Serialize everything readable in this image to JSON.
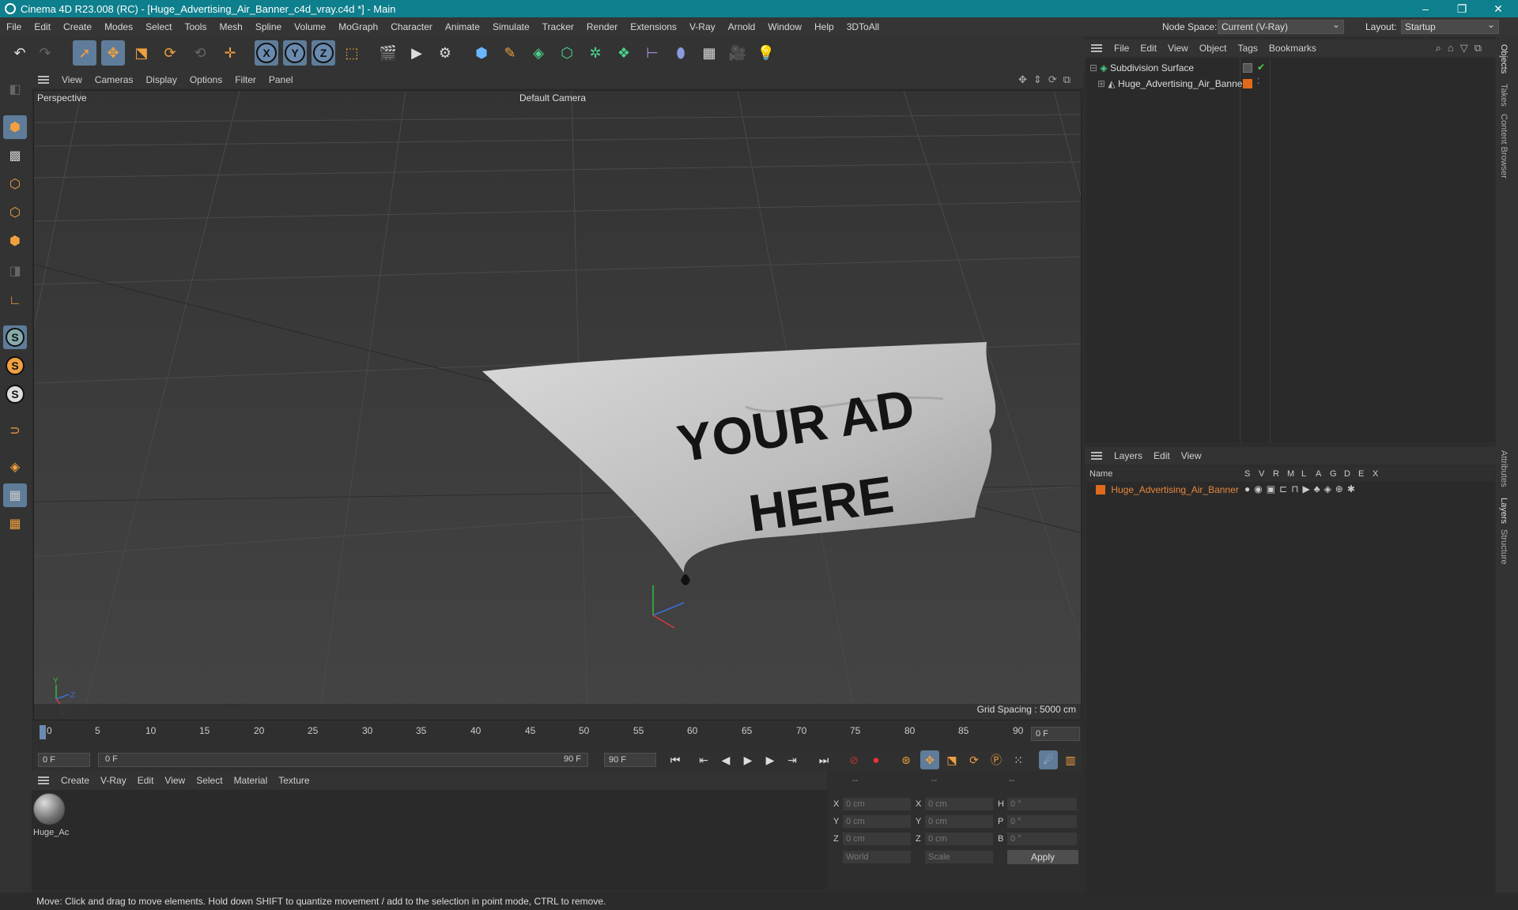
{
  "window": {
    "title": "Cinema 4D R23.008 (RC) - [Huge_Advertising_Air_Banner_c4d_vray.c4d *] - Main",
    "minimize": "–",
    "restore": "❐",
    "close": "✕"
  },
  "menubar": {
    "items": [
      "File",
      "Edit",
      "Create",
      "Modes",
      "Select",
      "Tools",
      "Mesh",
      "Spline",
      "Volume",
      "MoGraph",
      "Character",
      "Animate",
      "Simulate",
      "Tracker",
      "Render",
      "Extensions",
      "V-Ray",
      "Arnold",
      "Window",
      "Help",
      "3DToAll"
    ],
    "node_space_label": "Node Space:",
    "node_space_value": "Current (V-Ray)",
    "layout_label": "Layout:",
    "layout_value": "Startup"
  },
  "toolbar": {
    "axis_x": "X",
    "axis_y": "Y",
    "axis_z": "Z"
  },
  "lefttools": {
    "s1": "S",
    "s2": "S",
    "s3": "S"
  },
  "viewport_menu": {
    "items": [
      "View",
      "Cameras",
      "Display",
      "Options",
      "Filter",
      "Panel"
    ]
  },
  "viewport": {
    "label": "Perspective",
    "camera": "Default Camera",
    "grid_spacing": "Grid Spacing : 5000 cm",
    "banner_text_line1": "YOUR AD",
    "banner_text_line2": "HERE",
    "axis_y": "Y",
    "axis_z": "Z",
    "axis_x": "X"
  },
  "timeline": {
    "ticks": [
      "0",
      "5",
      "10",
      "15",
      "20",
      "25",
      "30",
      "35",
      "40",
      "45",
      "50",
      "55",
      "60",
      "65",
      "70",
      "75",
      "80",
      "85",
      "90"
    ],
    "current_frame": "0 F"
  },
  "transport": {
    "start": "0 F",
    "range_start": "0 F",
    "range_end": "90 F",
    "end": "90 F"
  },
  "material_menu": {
    "items": [
      "Create",
      "V-Ray",
      "Edit",
      "View",
      "Select",
      "Material",
      "Texture"
    ]
  },
  "materials": [
    {
      "name": "Huge_Ac"
    }
  ],
  "coords": {
    "headers": [
      "--",
      "--",
      "--"
    ],
    "rows": [
      {
        "l1": "X",
        "v1": "0 cm",
        "l2": "X",
        "v2": "0 cm",
        "l3": "H",
        "v3": "0 °"
      },
      {
        "l1": "Y",
        "v1": "0 cm",
        "l2": "Y",
        "v2": "0 cm",
        "l3": "P",
        "v3": "0 °"
      },
      {
        "l1": "Z",
        "v1": "0 cm",
        "l2": "Z",
        "v2": "0 cm",
        "l3": "B",
        "v3": "0 °"
      }
    ],
    "mode1": "World",
    "mode2": "Scale",
    "apply": "Apply"
  },
  "objects_menu": {
    "items": [
      "File",
      "Edit",
      "View",
      "Object",
      "Tags",
      "Bookmarks"
    ]
  },
  "objects": [
    {
      "name": "Subdivision Surface"
    },
    {
      "name": "Huge_Advertising_Air_Banner"
    }
  ],
  "layers_menu": {
    "items": [
      "Layers",
      "Edit",
      "View"
    ]
  },
  "layers_header": {
    "name": "Name",
    "cols": [
      "S",
      "V",
      "R",
      "M",
      "L",
      "A",
      "G",
      "D",
      "E",
      "X"
    ]
  },
  "layers": [
    {
      "name": "Huge_Advertising_Air_Banner",
      "color": "#e06a1b"
    }
  ],
  "side_tabs": [
    "Objects",
    "Takes",
    "Content Browser",
    "Attributes",
    "Layers",
    "Structure"
  ],
  "status": "Move: Click and drag to move elements. Hold down SHIFT to quantize movement / add to the selection in point mode, CTRL to remove."
}
